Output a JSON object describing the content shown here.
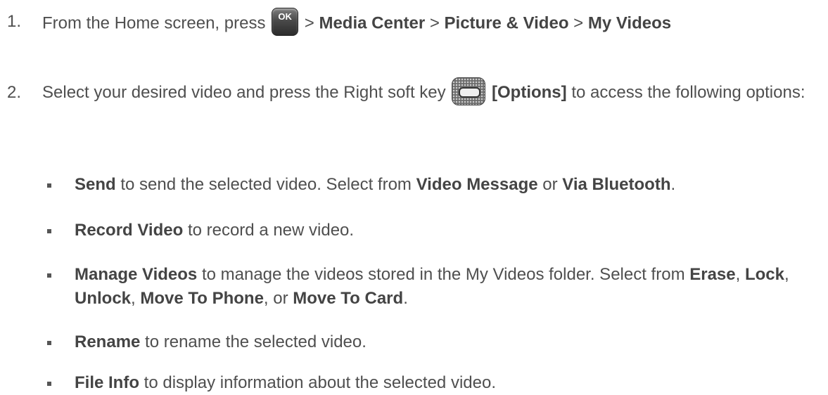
{
  "step1": {
    "number": "1.",
    "prefix": "From the Home screen, press",
    "key_icon": "ok-key-icon",
    "key_label": "OK",
    "sep1": ">",
    "path1": "Media Center",
    "sep2": ">",
    "path2": "Picture & Video",
    "sep3": ">",
    "path3": "My Videos"
  },
  "step2": {
    "number": "2.",
    "prefix": "Select  your desired video and press the Right soft key",
    "key_icon": "right-soft-key-icon",
    "options_label": "[Options]",
    "suffix": "to access the following options:"
  },
  "bullets": [
    {
      "term": "Send",
      "text": "to send the selected video. Select from",
      "opt1": "Video Message",
      "or": "or",
      "opt2": "Via Bluetooth",
      "end": "."
    },
    {
      "term": "Record Video",
      "text": "to record a new video."
    },
    {
      "term": "Manage Videos",
      "text": "to manage the videos stored in the My Videos folder. Select from",
      "opt1": "Erase",
      "opt2": "Lock",
      "opt3": "Unlock",
      "opt4": "Move To Phone",
      "or": "or",
      "opt5": "Move To Card",
      "comma": ",",
      "end": "."
    },
    {
      "term": "Rename",
      "text": "to rename the selected video."
    },
    {
      "term": "File Info",
      "text": "to display information about the selected video."
    }
  ]
}
